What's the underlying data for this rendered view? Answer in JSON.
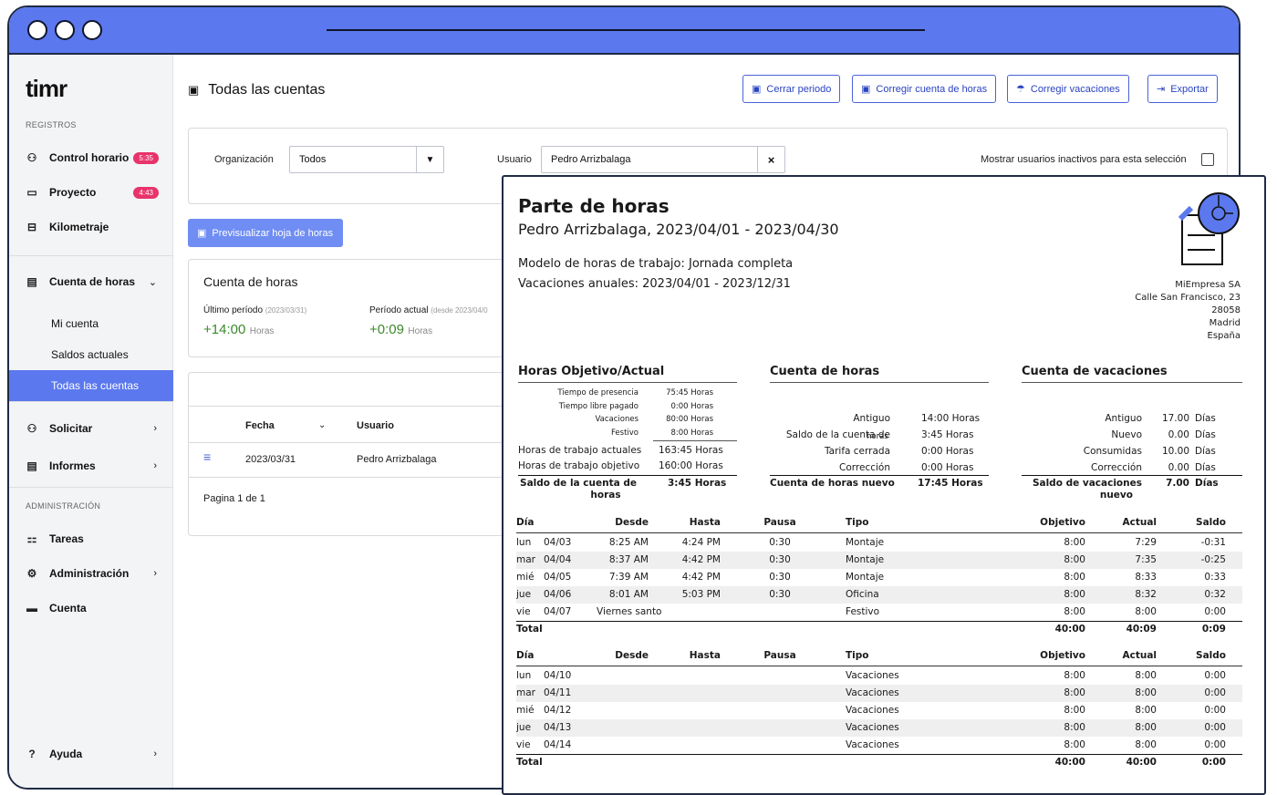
{
  "app": {
    "logo": "timr"
  },
  "sidebar": {
    "section_registros": "REGISTROS",
    "section_admin": "ADMINISTRACIÓN",
    "items": [
      {
        "label": "Control horario",
        "badge": "5:35"
      },
      {
        "label": "Proyecto",
        "badge": "4:43"
      },
      {
        "label": "Kilometraje"
      },
      {
        "label": "Cuenta de horas"
      },
      {
        "label": "Solicitar"
      },
      {
        "label": "Informes"
      },
      {
        "label": "Tareas"
      },
      {
        "label": "Administración"
      },
      {
        "label": "Cuenta"
      },
      {
        "label": "Ayuda"
      }
    ],
    "subitems": [
      "Mi cuenta",
      "Saldos actuales",
      "Todas las cuentas"
    ]
  },
  "header": {
    "title": "Todas las cuentas",
    "buttons": [
      "Cerrar periodo",
      "Corregir cuenta de horas",
      "Corregir vacaciones",
      "Exportar"
    ]
  },
  "filters": {
    "org_label": "Organización",
    "org_value": "Todos",
    "user_label": "Usuario",
    "user_value": "Pedro Arrizbalaga",
    "inactive_label": "Mostrar usuarios inactivos para esta selección"
  },
  "preview_button": "Previsualizar hoja de horas",
  "account_card": {
    "title": "Cuenta de horas",
    "last_label": "Último período",
    "last_date": "(2023/03/31)",
    "last_value": "+14:00",
    "last_unit": "Horas",
    "current_label": "Período actual",
    "current_date": "(desde 2023/04/0",
    "current_value": "+0:09",
    "current_unit": "Horas"
  },
  "table": {
    "col_fecha": "Fecha",
    "col_usuario": "Usuario",
    "row_date": "2023/03/31",
    "row_user": "Pedro Arrizbalaga",
    "pagination": "Pagina 1 de 1"
  },
  "report": {
    "title": "Parte de horas",
    "subtitle": "Pedro Arrizbalaga, 2023/04/01 - 2023/04/30",
    "model": "Modelo de horas de trabajo: Jornada completa",
    "vacation": "Vacaciones anuales: 2023/04/01 - 2023/12/31",
    "company": [
      "MiEmpresa SA",
      "Calle San Francisco, 23",
      "28058",
      "Madrid",
      "España"
    ],
    "obj_title": "Horas Objetivo/Actual",
    "obj_small": [
      [
        "Tiempo de presencia",
        "75:45 Horas"
      ],
      [
        "Tiempo libre pagado",
        "0:00 Horas"
      ],
      [
        "Vacaciones",
        "80:00 Horas"
      ],
      [
        "Festivo",
        "8:00 Horas"
      ]
    ],
    "obj_rows": [
      [
        "Horas de trabajo actuales",
        "163:45 Horas"
      ],
      [
        "Horas de trabajo objetivo",
        "160:00 Horas"
      ]
    ],
    "obj_total": [
      "Saldo de la cuenta de",
      "horas",
      "3:45 Horas"
    ],
    "acc_title": "Cuenta de horas",
    "acc_rows": [
      [
        "Antiguo",
        "14:00 Horas"
      ],
      [
        "Saldo de la cuenta de",
        "3:45 Horas"
      ],
      [
        "Tarifa cerrada",
        "0:00 Horas"
      ],
      [
        "Corrección",
        "0:00 Horas"
      ]
    ],
    "acc_overlap": "horas",
    "acc_total": [
      "Cuenta de horas nuevo",
      "17:45 Horas"
    ],
    "vac_title": "Cuenta de vacaciones",
    "vac_rows": [
      [
        "Antiguo",
        "17.00",
        "Días"
      ],
      [
        "Nuevo",
        "0.00",
        "Días"
      ],
      [
        "Consumidas",
        "10.00",
        "Días"
      ],
      [
        "Corrección",
        "0.00",
        "Días"
      ]
    ],
    "vac_total": [
      "Saldo de vacaciones",
      "nuevo",
      "7.00",
      "Días"
    ],
    "cols": [
      "Día",
      "Desde",
      "Hasta",
      "Pausa",
      "Tipo",
      "Objetivo",
      "Actual",
      "Saldo"
    ],
    "week1": [
      [
        "lun",
        "04/03",
        "8:25 AM",
        "4:24 PM",
        "0:30",
        "Montaje",
        "8:00",
        "7:29",
        "-0:31"
      ],
      [
        "mar",
        "04/04",
        "8:37 AM",
        "4:42 PM",
        "0:30",
        "Montaje",
        "8:00",
        "7:35",
        "-0:25"
      ],
      [
        "mié",
        "04/05",
        "7:39 AM",
        "4:42 PM",
        "0:30",
        "Montaje",
        "8:00",
        "8:33",
        "0:33"
      ],
      [
        "jue",
        "04/06",
        "8:01 AM",
        "5:03 PM",
        "0:30",
        "Oficina",
        "8:00",
        "8:32",
        "0:32"
      ],
      [
        "vie",
        "04/07",
        "Viernes santo",
        "",
        "",
        "Festivo",
        "8:00",
        "8:00",
        "0:00"
      ]
    ],
    "week1_total": [
      "Total",
      "40:00",
      "40:09",
      "0:09"
    ],
    "week2": [
      [
        "lun",
        "04/10",
        "",
        "",
        "",
        "Vacaciones",
        "8:00",
        "8:00",
        "0:00"
      ],
      [
        "mar",
        "04/11",
        "",
        "",
        "",
        "Vacaciones",
        "8:00",
        "8:00",
        "0:00"
      ],
      [
        "mié",
        "04/12",
        "",
        "",
        "",
        "Vacaciones",
        "8:00",
        "8:00",
        "0:00"
      ],
      [
        "jue",
        "04/13",
        "",
        "",
        "",
        "Vacaciones",
        "8:00",
        "8:00",
        "0:00"
      ],
      [
        "vie",
        "04/14",
        "",
        "",
        "",
        "Vacaciones",
        "8:00",
        "8:00",
        "0:00"
      ]
    ],
    "week2_total": [
      "Total",
      "40:00",
      "40:00",
      "0:00"
    ]
  }
}
